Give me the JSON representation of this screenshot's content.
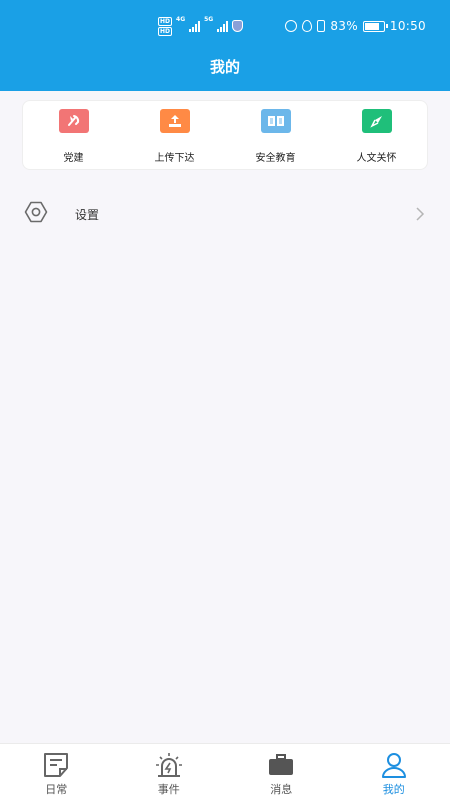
{
  "status_bar": {
    "hd1": "HD",
    "hd2": "HD",
    "net1": "4G",
    "net2": "5G",
    "battery_percent": "83%",
    "battery_level": 0.83,
    "time": "10:50"
  },
  "header": {
    "title": "我的"
  },
  "quick_actions": [
    {
      "label": "党建",
      "icon": "party-emblem-icon",
      "color": "#f27575"
    },
    {
      "label": "上传下达",
      "icon": "upload-icon",
      "color": "#ff8a45"
    },
    {
      "label": "安全教育",
      "icon": "book-icon",
      "color": "#6cb7ea"
    },
    {
      "label": "人文关怀",
      "icon": "compass-icon",
      "color": "#1fbf7a"
    }
  ],
  "menu": [
    {
      "label": "设置",
      "icon": "settings-icon"
    }
  ],
  "tabs": [
    {
      "label": "日常",
      "icon": "daily-note-icon",
      "active": false
    },
    {
      "label": "事件",
      "icon": "alarm-icon",
      "active": false
    },
    {
      "label": "消息",
      "icon": "briefcase-icon",
      "active": false
    },
    {
      "label": "我的",
      "icon": "user-icon",
      "active": true
    }
  ],
  "colors": {
    "header_bg": "#1aa0e6",
    "page_bg": "#f7f6fa",
    "tab_active": "#1d8fe0",
    "tab_inactive": "#555555"
  }
}
